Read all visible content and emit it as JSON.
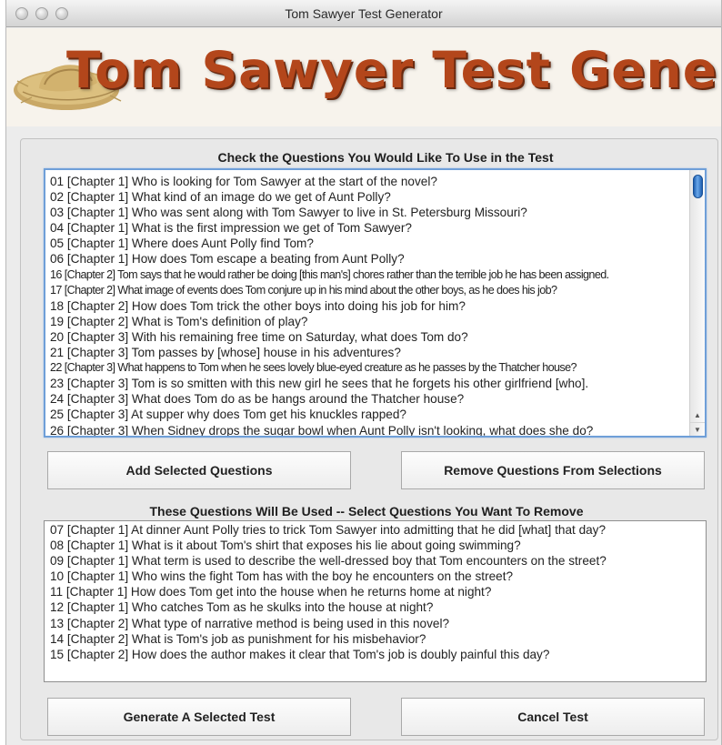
{
  "window": {
    "title": "Tom Sawyer Test Generator"
  },
  "banner": {
    "title": "Tom Sawyer Test Generator"
  },
  "available": {
    "heading": "Check the Questions You Would Like To Use in the Test",
    "items": [
      "01 [Chapter 1]  Who is looking for Tom Sawyer at the start of the novel?",
      "02 [Chapter 1]  What kind of an image do we get of Aunt Polly?",
      "03 [Chapter 1]  Who was sent along with Tom Sawyer to live in St. Petersburg Missouri?",
      "04 [Chapter 1]  What is the first impression we get of Tom Sawyer?",
      "05 [Chapter 1]  Where does Aunt Polly find Tom?",
      "06 [Chapter 1]  How does Tom escape a beating from Aunt Polly?",
      "16 [Chapter 2]  Tom says that he would rather be doing [this man's] chores rather than the terrible job he has been assigned.",
      "17 [Chapter 2]  What image of events does Tom conjure up in his mind about  the other boys, as he does his job?",
      "18 [Chapter 2]  How does Tom trick the other boys into doing his job for him?",
      "19 [Chapter 2]  What is Tom's definition of play?",
      "20 [Chapter 3]  With his remaining free time on Saturday, what does Tom do?",
      "21 [Chapter 3]  Tom passes by [whose] house in his adventures?",
      "22 [Chapter 3]  What happens to Tom when he sees lovely blue-eyed creature as he passes by the Thatcher house?",
      "23 [Chapter 3]  Tom is so smitten with this new girl he sees that he forgets his other girlfriend [who].",
      "24 [Chapter 3]  What does Tom do as be hangs around the Thatcher house?",
      "25 [Chapter 3]  At supper why does Tom get his knuckles rapped?",
      "26 [Chapter 3]  When Sidney drops the sugar bowl when Aunt Polly isn't looking, what does she do?"
    ]
  },
  "buttons": {
    "add": "Add Selected Questions",
    "remove": "Remove Questions From Selections",
    "generate": "Generate A Selected Test",
    "cancel": "Cancel Test"
  },
  "selected": {
    "heading": "These Questions Will Be Used -- Select Questions You Want To Remove",
    "items": [
      "07 [Chapter 1]  At dinner Aunt Polly tries to trick Tom Sawyer into admitting that he did [what] that day?",
      "08 [Chapter 1]  What is it about Tom's shirt that exposes his lie about going swimming?",
      "09 [Chapter 1]  What term is used to describe the well-dressed boy that Tom encounters on the street?",
      "10 [Chapter 1]  Who wins the fight Tom has with the boy he encounters on the street?",
      "11 [Chapter 1]  How does Tom get into the house when he returns home at night?",
      "12 [Chapter 1]  Who catches Tom as he skulks into the house at night?",
      "13 [Chapter 2]  What type of narrative method is being used in this novel?",
      "14 [Chapter 2]  What is Tom's job as punishment for his misbehavior?",
      "15 [Chapter 2]  How does the author makes it clear that Tom's job is doubly painful this day?"
    ]
  },
  "icons": {
    "scroll_up": "up-arrow-icon",
    "scroll_down": "down-arrow-icon",
    "logo": "straw-hat-icon"
  },
  "colors": {
    "banner_text": "#b3461b",
    "focus_ring": "#6f9fd8",
    "scroll_thumb": "#3a7fd0"
  }
}
